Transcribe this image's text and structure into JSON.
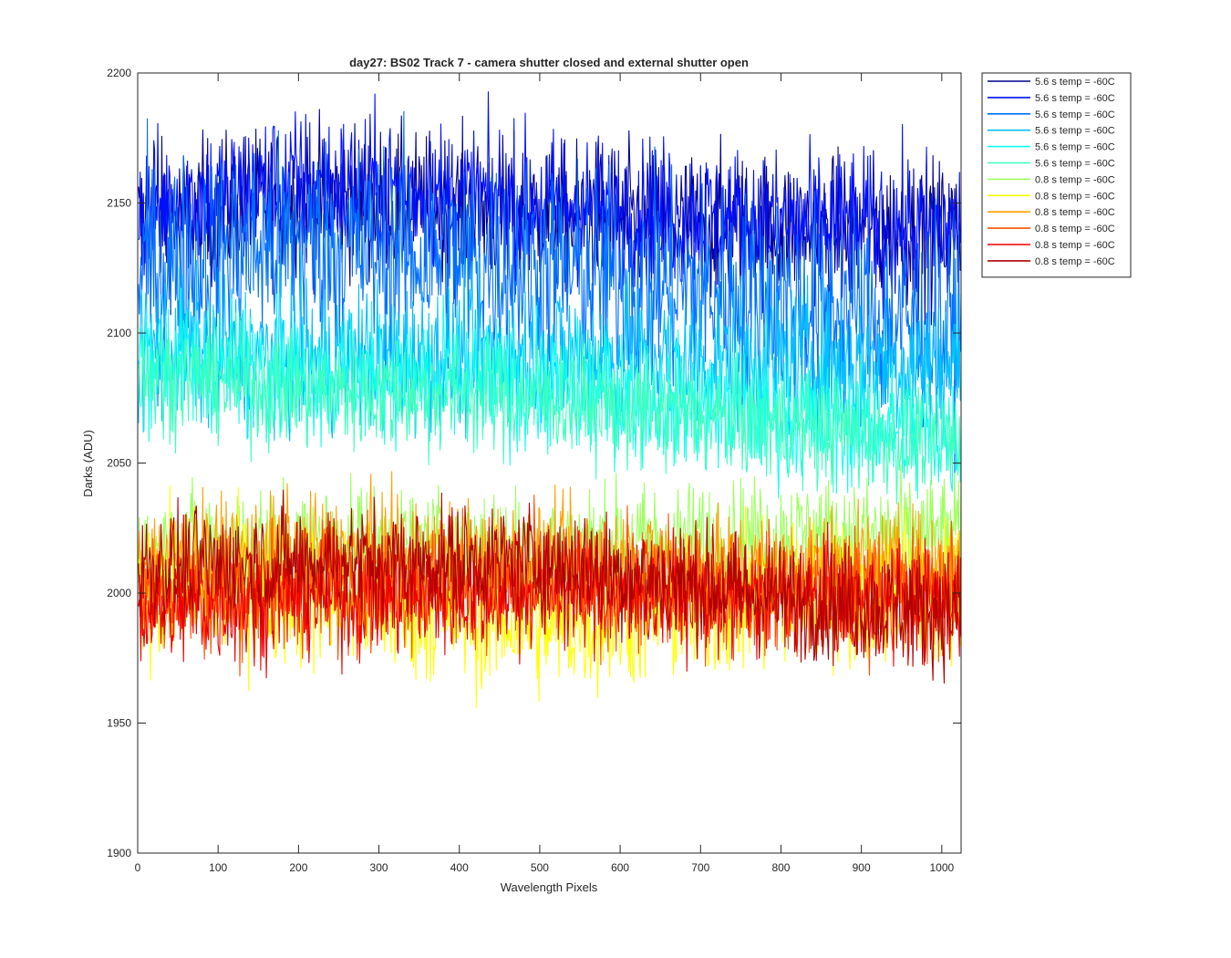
{
  "chart_data": {
    "type": "line",
    "title": "day27: BS02  Track 7 - camera shutter closed and external shutter open",
    "xlabel": "Wavelength Pixels",
    "ylabel": "Darks (ADU)",
    "xlim": [
      0,
      1024
    ],
    "ylim": [
      1900,
      2200
    ],
    "xticks": [
      0,
      100,
      200,
      300,
      400,
      500,
      600,
      700,
      800,
      900,
      1000
    ],
    "yticks": [
      1900,
      1950,
      2000,
      2050,
      2100,
      2150,
      2200
    ],
    "grid": false,
    "legend_position": "outside-top-right",
    "series": [
      {
        "name": "5.6 s temp = -60C",
        "color": "#00008f",
        "profile": [
          [
            0,
            2142
          ],
          [
            200,
            2152
          ],
          [
            500,
            2145
          ],
          [
            800,
            2140
          ],
          [
            1024,
            2138
          ]
        ],
        "noise": 14
      },
      {
        "name": "5.6 s temp = -60C",
        "color": "#0010ff",
        "profile": [
          [
            0,
            2148
          ],
          [
            200,
            2158
          ],
          [
            500,
            2150
          ],
          [
            800,
            2142
          ],
          [
            1024,
            2140
          ]
        ],
        "noise": 14
      },
      {
        "name": "5.6 s temp = -60C",
        "color": "#0070ff",
        "profile": [
          [
            0,
            2125
          ],
          [
            200,
            2135
          ],
          [
            500,
            2125
          ],
          [
            800,
            2112
          ],
          [
            1024,
            2100
          ]
        ],
        "noise": 20
      },
      {
        "name": "5.6 s temp = -60C",
        "color": "#00c0ff",
        "profile": [
          [
            0,
            2095
          ],
          [
            200,
            2090
          ],
          [
            500,
            2092
          ],
          [
            800,
            2090
          ],
          [
            1024,
            2088
          ]
        ],
        "noise": 14
      },
      {
        "name": "5.6 s temp = -60C",
        "color": "#10ffef",
        "profile": [
          [
            0,
            2092
          ],
          [
            200,
            2085
          ],
          [
            500,
            2080
          ],
          [
            800,
            2068
          ],
          [
            1024,
            2060
          ]
        ],
        "noise": 12
      },
      {
        "name": "5.6 s temp = -60C",
        "color": "#40ffbf",
        "profile": [
          [
            0,
            2085
          ],
          [
            200,
            2078
          ],
          [
            500,
            2075
          ],
          [
            800,
            2065
          ],
          [
            1024,
            2058
          ]
        ],
        "noise": 11
      },
      {
        "name": "0.8 s temp = -60C",
        "color": "#9fff60",
        "profile": [
          [
            0,
            2015
          ],
          [
            200,
            2020
          ],
          [
            500,
            2018
          ],
          [
            800,
            2022
          ],
          [
            1024,
            2022
          ]
        ],
        "noise": 11
      },
      {
        "name": "0.8 s temp = -60C",
        "color": "#ffff00",
        "profile": [
          [
            0,
            2002
          ],
          [
            200,
            2000
          ],
          [
            500,
            1988
          ],
          [
            800,
            1998
          ],
          [
            1024,
            2002
          ]
        ],
        "noise": 14
      },
      {
        "name": "0.8 s temp = -60C",
        "color": "#ffa000",
        "profile": [
          [
            0,
            2012
          ],
          [
            200,
            2015
          ],
          [
            500,
            2012
          ],
          [
            800,
            2008
          ],
          [
            1024,
            2010
          ]
        ],
        "noise": 11
      },
      {
        "name": "0.8 s temp = -60C",
        "color": "#ff5000",
        "profile": [
          [
            0,
            2000
          ],
          [
            200,
            2002
          ],
          [
            500,
            2005
          ],
          [
            800,
            2000
          ],
          [
            1024,
            2000
          ]
        ],
        "noise": 12
      },
      {
        "name": "0.8 s temp = -60C",
        "color": "#ef0000",
        "profile": [
          [
            0,
            1993
          ],
          [
            200,
            1998
          ],
          [
            500,
            2000
          ],
          [
            800,
            1998
          ],
          [
            1024,
            1996
          ]
        ],
        "noise": 11
      },
      {
        "name": "0.8 s temp = -60C",
        "color": "#b00000",
        "profile": [
          [
            0,
            2010
          ],
          [
            200,
            2012
          ],
          [
            500,
            2012
          ],
          [
            800,
            1998
          ],
          [
            1024,
            1992
          ]
        ],
        "noise": 11
      }
    ]
  }
}
